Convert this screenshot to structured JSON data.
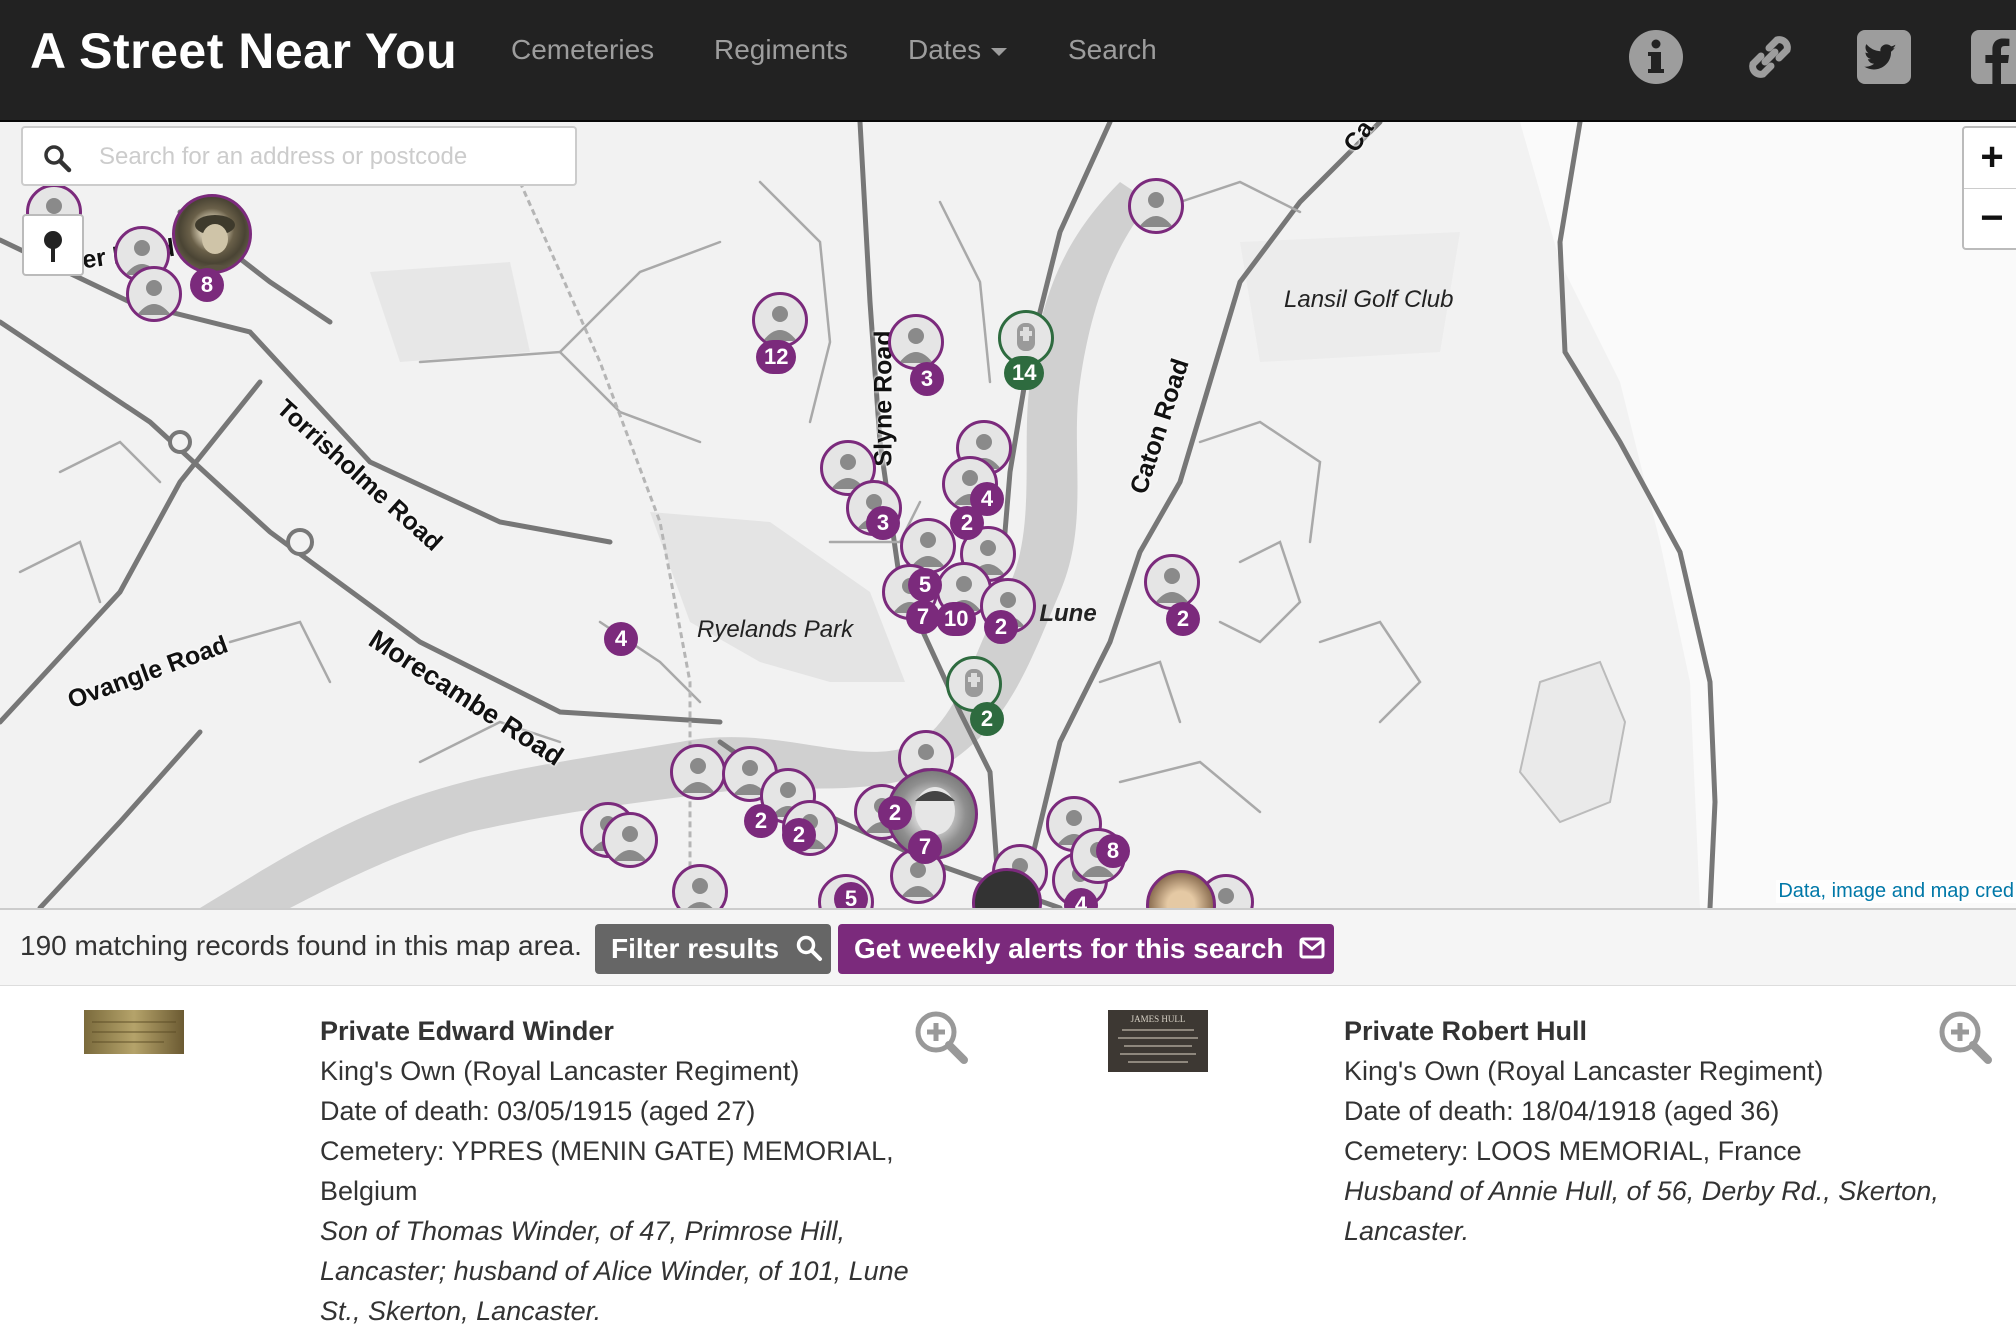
{
  "navbar": {
    "brand": "A Street Near You",
    "links": [
      "Cemeteries",
      "Regiments",
      "Dates",
      "Search"
    ],
    "icons": [
      "info-icon",
      "link-icon",
      "twitter-icon",
      "facebook-icon"
    ]
  },
  "map": {
    "search_placeholder": "Search for an address or postcode",
    "zoom_in": "+",
    "zoom_out": "−",
    "credit": "Data, image and map cred",
    "place_labels": [
      "Lansil Golf Club",
      "Ryelands Park",
      "er Lune"
    ],
    "road_labels": [
      "Ca",
      "er Road",
      "Slyne Road",
      "Torrisholme Road",
      "Caton Road",
      "Morecambe Road",
      "Ovangle Road"
    ],
    "cluster_counts": [
      "8",
      "12",
      "3",
      "14",
      "4",
      "3",
      "2",
      "5",
      "7",
      "10",
      "2",
      "2",
      "2",
      "4",
      "2",
      "2",
      "7",
      "2",
      "5",
      "8",
      "4"
    ],
    "colors": {
      "soldier": "#7b2a7c",
      "cemetery": "#2e6b3f"
    }
  },
  "results": {
    "count_text": "190 matching records found in this map area.",
    "filter_label": "Filter results",
    "alerts_label": "Get weekly alerts for this search"
  },
  "records": [
    {
      "name": "Private Edward Winder",
      "regiment": "King's Own (Royal Lancaster Regiment)",
      "death": "Date of death: 03/05/1915 (aged 27)",
      "cemetery_1": "Cemetery: YPRES (MENIN GATE) MEMORIAL,",
      "cemetery_2": "Belgium",
      "note_1": "Son of Thomas Winder, of 47, Primrose Hill,",
      "note_2": "Lancaster; husband of Alice Winder, of 101, Lune",
      "note_3": "St., Skerton, Lancaster."
    },
    {
      "name": "Private Robert Hull",
      "regiment": "King's Own (Royal Lancaster Regiment)",
      "death": "Date of death: 18/04/1918 (aged 36)",
      "cemetery_1": "Cemetery: LOOS MEMORIAL, France",
      "note_1": "Husband of Annie Hull, of 56, Derby Rd., Skerton,",
      "note_2": "Lancaster.",
      "thumb_text": "JAMES HULL"
    }
  ]
}
